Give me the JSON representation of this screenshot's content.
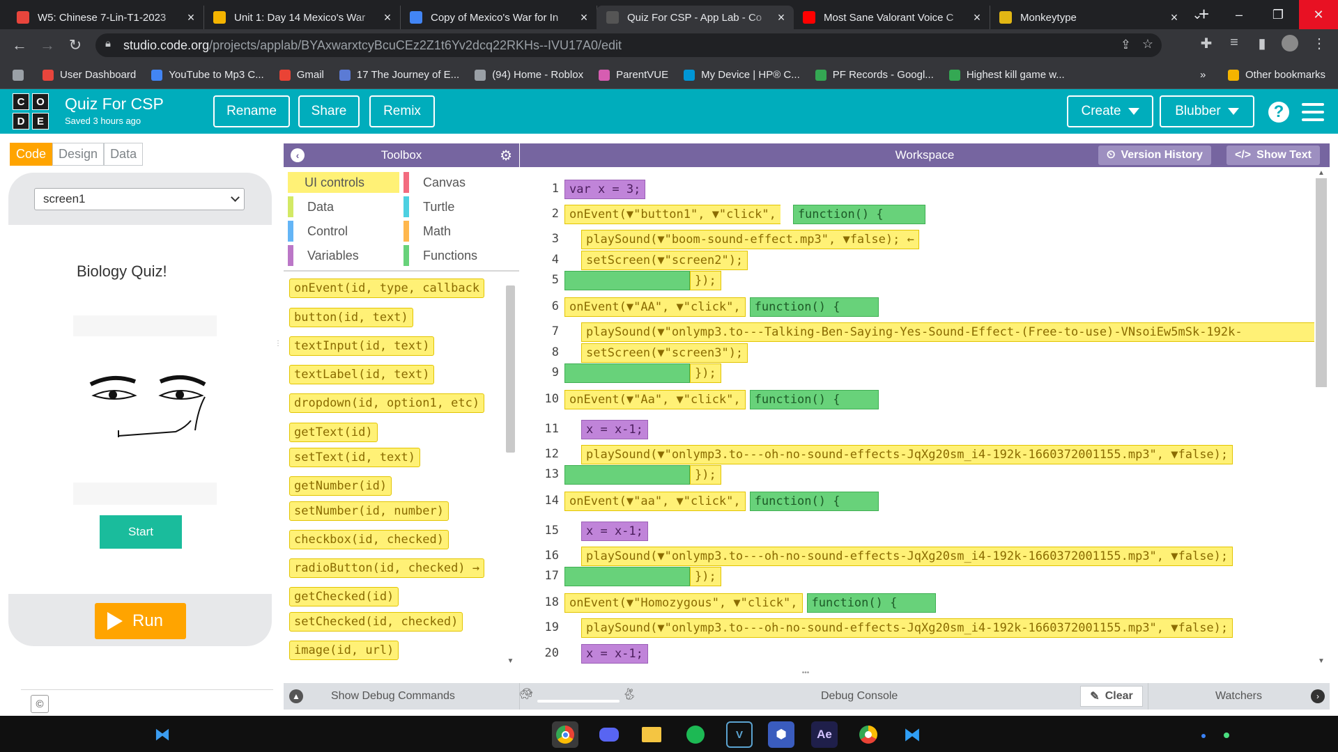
{
  "tabs": [
    {
      "title": "W5: Chinese 7-Lin-T1-2023",
      "favicon_color": "#e8453c"
    },
    {
      "title": "Unit 1: Day 14 Mexico's War",
      "favicon_color": "#f4b400"
    },
    {
      "title": "Copy of Mexico's War for In",
      "favicon_color": "#4285f4"
    },
    {
      "title": "Quiz For CSP - App Lab - Co",
      "favicon_color": "#555555",
      "active": true
    },
    {
      "title": "Most Sane Valorant Voice C",
      "favicon_color": "#ff0000"
    },
    {
      "title": "Monkeytype",
      "favicon_color": "#e2b714"
    }
  ],
  "address": {
    "host": "studio.code.org",
    "path": "/projects/applab/BYAxwarxtcyBcuCEz2Z1t6Yv2dcq22RKHs--IVU17A0/edit"
  },
  "bookmarks": [
    {
      "label": "User Dashboard",
      "color": "#e8453c"
    },
    {
      "label": "YouTube to Mp3 C...",
      "color": "#4285f4"
    },
    {
      "label": "Gmail",
      "color": "#ea4335"
    },
    {
      "label": "17 The Journey of E...",
      "color": "#5b7bd5"
    },
    {
      "label": "(94) Home - Roblox",
      "color": "#9aa0a6"
    },
    {
      "label": "ParentVUE",
      "color": "#d65db1"
    },
    {
      "label": "My Device | HP® C...",
      "color": "#0096d6"
    },
    {
      "label": "PF Records - Googl...",
      "color": "#34a853"
    },
    {
      "label": "Highest kill game w...",
      "color": "#34a853"
    }
  ],
  "bookmarks_more": "»",
  "other_bookmarks": "Other bookmarks",
  "app": {
    "logo_letters": [
      "C",
      "O",
      "D",
      "E"
    ],
    "title": "Quiz For CSP",
    "saved": "Saved 3 hours ago",
    "rename": "Rename",
    "share": "Share",
    "remix": "Remix",
    "create": "Create",
    "user": "Blubber",
    "help": "?"
  },
  "modes": {
    "code": "Code",
    "design": "Design",
    "data": "Data"
  },
  "phone": {
    "screen": "screen1",
    "quiz_title": "Biology Quiz!",
    "start": "Start",
    "run": "Run",
    "copyright": "©"
  },
  "toolbox": {
    "title": "Toolbox",
    "categories": [
      {
        "label": "UI controls",
        "color": "#fff176"
      },
      {
        "label": "Canvas",
        "color": "#f36b7f"
      },
      {
        "label": "Data",
        "color": "#d3e965"
      },
      {
        "label": "Turtle",
        "color": "#4dd0e1"
      },
      {
        "label": "Control",
        "color": "#64b5f6"
      },
      {
        "label": "Math",
        "color": "#ffb74d"
      },
      {
        "label": "Variables",
        "color": "#bb77c7"
      },
      {
        "label": "Functions",
        "color": "#68d27a"
      }
    ],
    "blocks": [
      "onEvent(id, type, callback",
      "button(id, text)",
      "textInput(id, text)",
      "textLabel(id, text)",
      "dropdown(id, option1, etc)",
      "getText(id)",
      "setText(id, text)",
      "getNumber(id)",
      "setNumber(id, number)",
      "checkbox(id, checked)",
      "radioButton(id, checked) →",
      "getChecked(id)",
      "setChecked(id, checked)",
      "image(id, url)"
    ]
  },
  "workspace": {
    "title": "Workspace",
    "version_history": "Version History",
    "show_text": "Show Text",
    "line_numbers": [
      "1",
      "2",
      "3",
      "4",
      "5",
      "6",
      "7",
      "8",
      "9",
      "10",
      "11",
      "12",
      "13",
      "14",
      "15",
      "16",
      "17",
      "18",
      "19",
      "20"
    ],
    "lines": {
      "l1": "var x = 3;",
      "l2a": "onEvent(▼\"button1\", ▼\"click\",",
      "l2b": "function() {",
      "l3": "playSound(▼\"boom-sound-effect.mp3\", ▼false); ←",
      "l4": "setScreen(▼\"screen2\");",
      "l5": "});",
      "l6a": "onEvent(▼\"AA\", ▼\"click\",",
      "l6b": "function() {",
      "l7": "playSound(▼\"onlymp3.to---Talking-Ben-Saying-Yes-Sound-Effect-(Free-to-use)-VNsoiEw5mSk-192k-",
      "l8": "setScreen(▼\"screen3\");",
      "l9": "});",
      "l10a": "onEvent(▼\"Aa\", ▼\"click\",",
      "l10b": "function() {",
      "l11": "x = x-1;",
      "l12": "playSound(▼\"onlymp3.to---oh-no-sound-effects-JqXg20sm_i4-192k-1660372001155.mp3\", ▼false);",
      "l13": "});",
      "l14a": "onEvent(▼\"aa\", ▼\"click\",",
      "l14b": "function() {",
      "l15": "x = x-1;",
      "l16": "playSound(▼\"onlymp3.to---oh-no-sound-effects-JqXg20sm_i4-192k-1660372001155.mp3\", ▼false);",
      "l17": "});",
      "l18a": "onEvent(▼\"Homozygous\", ▼\"click\",",
      "l18b": "function() {",
      "l19": "playSound(▼\"onlymp3.to---oh-no-sound-effects-JqXg20sm_i4-192k-1660372001155.mp3\", ▼false);",
      "l20": "x = x-1;"
    }
  },
  "debug": {
    "show_commands": "Show Debug Commands",
    "console": "Debug Console",
    "clear": "Clear",
    "watchers": "Watchers"
  },
  "taskbar_apps": [
    "chrome-icon",
    "discord-icon",
    "file-explorer-icon",
    "spotify-icon",
    "vscode-icon",
    "rocket-icon",
    "after-effects-icon",
    "chrome-variant-icon",
    "vscode-blue-icon"
  ]
}
